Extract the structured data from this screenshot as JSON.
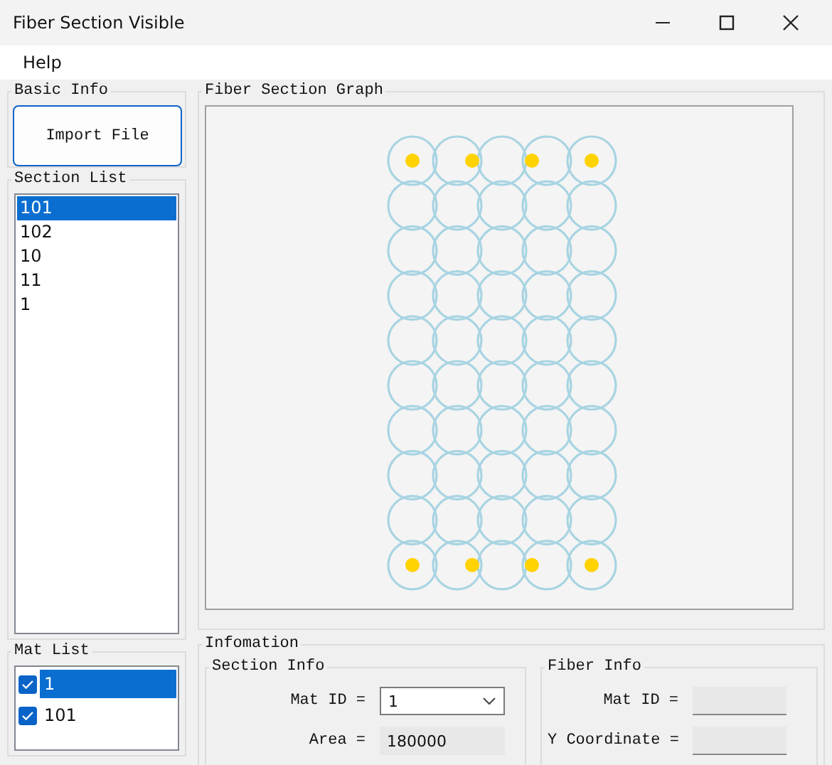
{
  "window": {
    "title": "Fiber Section Visible"
  },
  "menu": [
    "Help"
  ],
  "basic_info": {
    "title": "Basic Info",
    "import_button": "Import File"
  },
  "section_list": {
    "title": "Section List",
    "items": [
      {
        "label": "101",
        "selected": true
      },
      {
        "label": "102",
        "selected": false
      },
      {
        "label": "10",
        "selected": false
      },
      {
        "label": "11",
        "selected": false
      },
      {
        "label": "1",
        "selected": false
      }
    ]
  },
  "mat_list": {
    "title": "Mat List",
    "items": [
      {
        "label": "1",
        "checked": true,
        "selected": true
      },
      {
        "label": "101",
        "checked": true,
        "selected": false
      }
    ]
  },
  "graph": {
    "title": "Fiber Section Graph"
  },
  "information": {
    "title": "Infomation",
    "section_info": {
      "title": "Section Info",
      "mat_id_label": "Mat ID =",
      "mat_id": "1",
      "area_label": "Area =",
      "area": "180000"
    },
    "fiber_info": {
      "title": "Fiber Info",
      "fields": [
        {
          "label": "Mat ID ="
        },
        {
          "label": "Y Coordinate ="
        }
      ]
    }
  }
}
